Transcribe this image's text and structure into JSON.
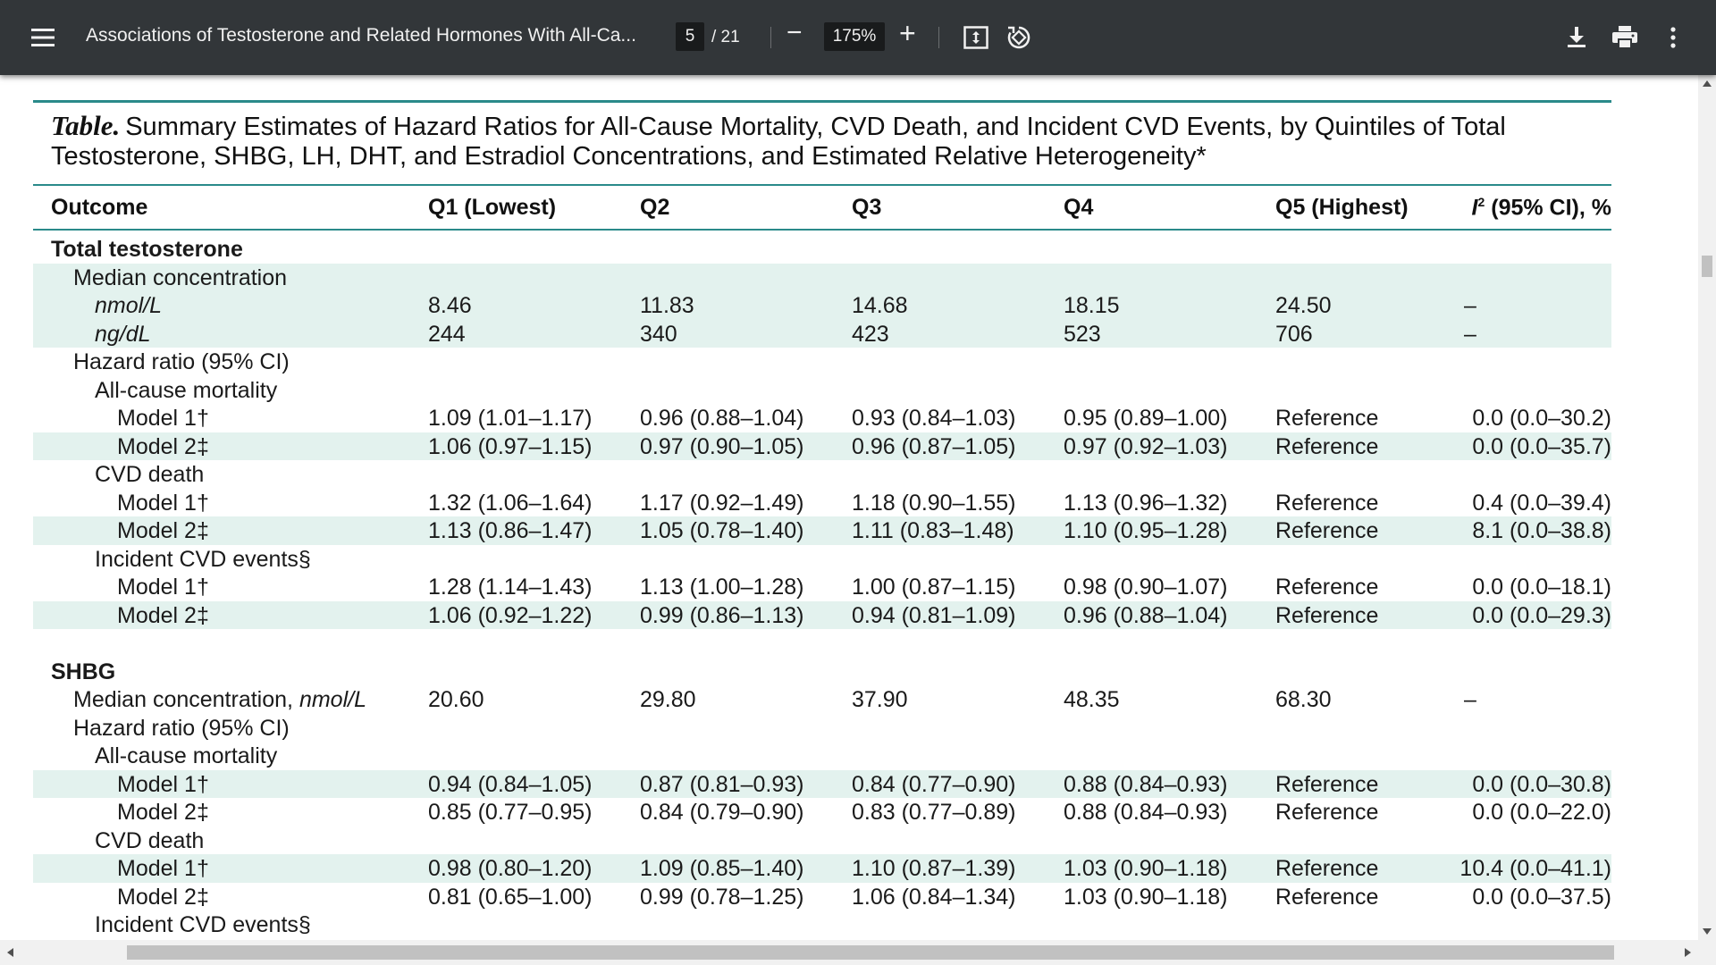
{
  "toolbar": {
    "doc_title": "Associations of Testosterone and Related Hormones With All-Ca...",
    "page_current": "5",
    "page_total": "/ 21",
    "zoom": "175%",
    "zoom_out": "−",
    "zoom_in": "+",
    "icons": [
      "menu-icon",
      "fit-page-icon",
      "rotate-icon",
      "download-icon",
      "print-icon",
      "more-vert-icon"
    ]
  },
  "table": {
    "caption_label": "Table.",
    "caption_text": "Summary Estimates of Hazard Ratios for All-Cause Mortality, CVD Death, and Incident CVD Events, by Quintiles of Total Testosterone, SHBG, LH, DHT, and Estradiol Concentrations, and Estimated Relative Heterogeneity*",
    "headers": {
      "outcome": "Outcome",
      "q1": "Q1 (Lowest)",
      "q2": "Q2",
      "q3": "Q3",
      "q4": "Q4",
      "q5": "Q5 (Highest)",
      "i2_letter": "I",
      "i2_sup": "2",
      "i2_rest": " (95% CI), %"
    },
    "rows": [
      {
        "label": "Total testosterone",
        "bold": true
      },
      {
        "label": "Median concentration",
        "indent": 1,
        "band": true
      },
      {
        "label": "nmol/L",
        "indent": 2,
        "italic": true,
        "band": true,
        "values": [
          "8.46",
          "11.83",
          "14.68",
          "18.15",
          "24.50"
        ],
        "i2": "–"
      },
      {
        "label": "ng/dL",
        "indent": 2,
        "italic": true,
        "band": true,
        "values": [
          "244",
          "340",
          "423",
          "523",
          "706"
        ],
        "i2": "–"
      },
      {
        "label": "Hazard ratio (95% CI)",
        "indent": 1
      },
      {
        "label": "All-cause mortality",
        "indent": 2
      },
      {
        "label": "Model 1†",
        "indent": 3,
        "values": [
          "1.09 (1.01–1.17)",
          "0.96 (0.88–1.04)",
          "0.93 (0.84–1.03)",
          "0.95 (0.89–1.00)",
          "Reference"
        ],
        "i2": "0.0 (0.0–30.2)"
      },
      {
        "label": "Model 2‡",
        "indent": 3,
        "band": true,
        "values": [
          "1.06 (0.97–1.15)",
          "0.97 (0.90–1.05)",
          "0.96 (0.87–1.05)",
          "0.97 (0.92–1.03)",
          "Reference"
        ],
        "i2": "0.0 (0.0–35.7)"
      },
      {
        "label": "CVD death",
        "indent": 2
      },
      {
        "label": "Model 1†",
        "indent": 3,
        "values": [
          "1.32 (1.06–1.64)",
          "1.17 (0.92–1.49)",
          "1.18 (0.90–1.55)",
          "1.13 (0.96–1.32)",
          "Reference"
        ],
        "i2": "0.4 (0.0–39.4)"
      },
      {
        "label": "Model 2‡",
        "indent": 3,
        "band": true,
        "values": [
          "1.13 (0.86–1.47)",
          "1.05 (0.78–1.40)",
          "1.11 (0.83–1.48)",
          "1.10 (0.95–1.28)",
          "Reference"
        ],
        "i2": "8.1 (0.0–38.8)"
      },
      {
        "label": "Incident CVD events§",
        "indent": 2
      },
      {
        "label": "Model 1†",
        "indent": 3,
        "values": [
          "1.28 (1.14–1.43)",
          "1.13 (1.00–1.28)",
          "1.00 (0.87–1.15)",
          "0.98 (0.90–1.07)",
          "Reference"
        ],
        "i2": "0.0 (0.0–18.1)"
      },
      {
        "label": "Model 2‡",
        "indent": 3,
        "band": true,
        "values": [
          "1.06 (0.92–1.22)",
          "0.99 (0.86–1.13)",
          "0.94 (0.81–1.09)",
          "0.96 (0.88–1.04)",
          "Reference"
        ],
        "i2": "0.0 (0.0–29.3)"
      },
      {
        "label": "",
        "spacer": true
      },
      {
        "label": "SHBG",
        "bold": true
      },
      {
        "label": "Median concentration, ",
        "label_italic": "nmol/L",
        "indent": 1,
        "values": [
          "20.60",
          "29.80",
          "37.90",
          "48.35",
          "68.30"
        ],
        "i2": "–"
      },
      {
        "label": "Hazard ratio (95% CI)",
        "indent": 1
      },
      {
        "label": "All-cause mortality",
        "indent": 2
      },
      {
        "label": "Model 1†",
        "indent": 3,
        "band": true,
        "values": [
          "0.94 (0.84–1.05)",
          "0.87 (0.81–0.93)",
          "0.84 (0.77–0.90)",
          "0.88 (0.84–0.93)",
          "Reference"
        ],
        "i2": "0.0 (0.0–30.8)"
      },
      {
        "label": "Model 2‡",
        "indent": 3,
        "values": [
          "0.85 (0.77–0.95)",
          "0.84 (0.79–0.90)",
          "0.83 (0.77–0.89)",
          "0.88 (0.84–0.93)",
          "Reference"
        ],
        "i2": "0.0 (0.0–22.0)"
      },
      {
        "label": "CVD death",
        "indent": 2
      },
      {
        "label": "Model 1†",
        "indent": 3,
        "band": true,
        "values": [
          "0.98 (0.80–1.20)",
          "1.09 (0.85–1.40)",
          "1.10 (0.87–1.39)",
          "1.03 (0.90–1.18)",
          "Reference"
        ],
        "i2": "10.4 (0.0–41.1)"
      },
      {
        "label": "Model 2‡",
        "indent": 3,
        "values": [
          "0.81 (0.65–1.00)",
          "0.99 (0.78–1.25)",
          "1.06 (0.84–1.34)",
          "1.03 (0.90–1.18)",
          "Reference"
        ],
        "i2": "0.0 (0.0–37.5)"
      },
      {
        "label": "Incident CVD events§",
        "indent": 2
      }
    ]
  },
  "colors": {
    "toolbar_bg": "#323639",
    "viewer_bg": "#525659",
    "rule": "#2a8a8a",
    "band": "#e3f2ee"
  }
}
